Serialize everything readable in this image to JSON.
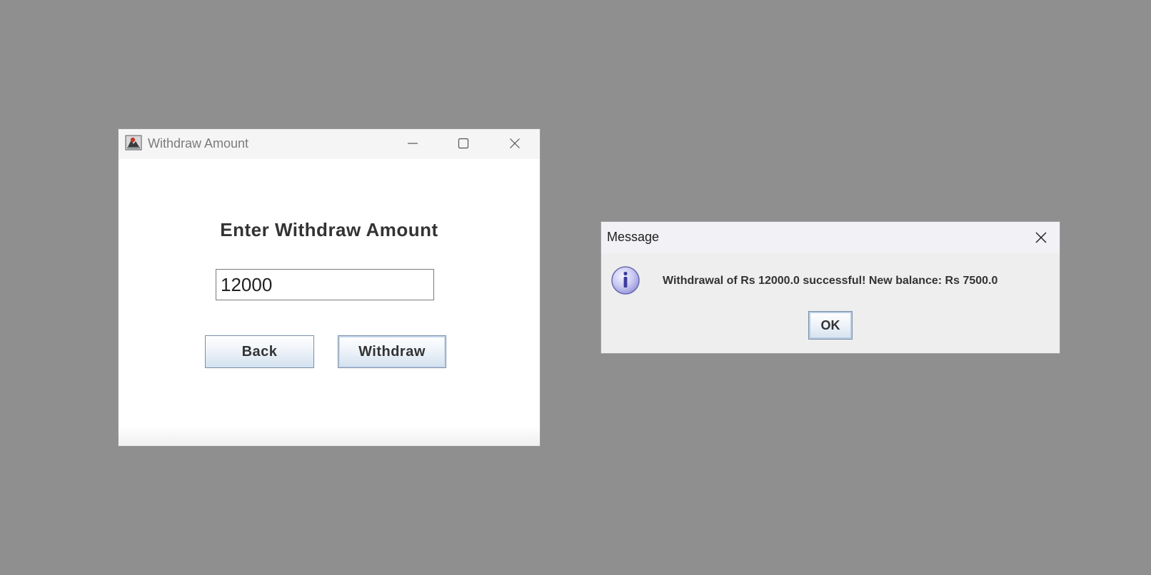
{
  "colors": {
    "desktop_background": "#8f8f8f",
    "window_background": "#ffffff",
    "dialog_background": "#eeeeee",
    "button_border": "#7a8ea8"
  },
  "withdraw_window": {
    "title": "Withdraw Amount",
    "heading": "Enter Withdraw Amount",
    "amount_input": {
      "value": "12000",
      "placeholder": ""
    },
    "back_label": "Back",
    "withdraw_label": "Withdraw",
    "icons": {
      "app": "java-app-icon",
      "minimize": "minimize-icon",
      "maximize": "maximize-icon",
      "close": "close-icon"
    }
  },
  "message_dialog": {
    "title": "Message",
    "message": "Withdrawal of Rs 12000.0 successful! New balance: Rs 7500.0",
    "ok_label": "OK",
    "icons": {
      "info": "info-icon",
      "close": "close-icon"
    }
  }
}
